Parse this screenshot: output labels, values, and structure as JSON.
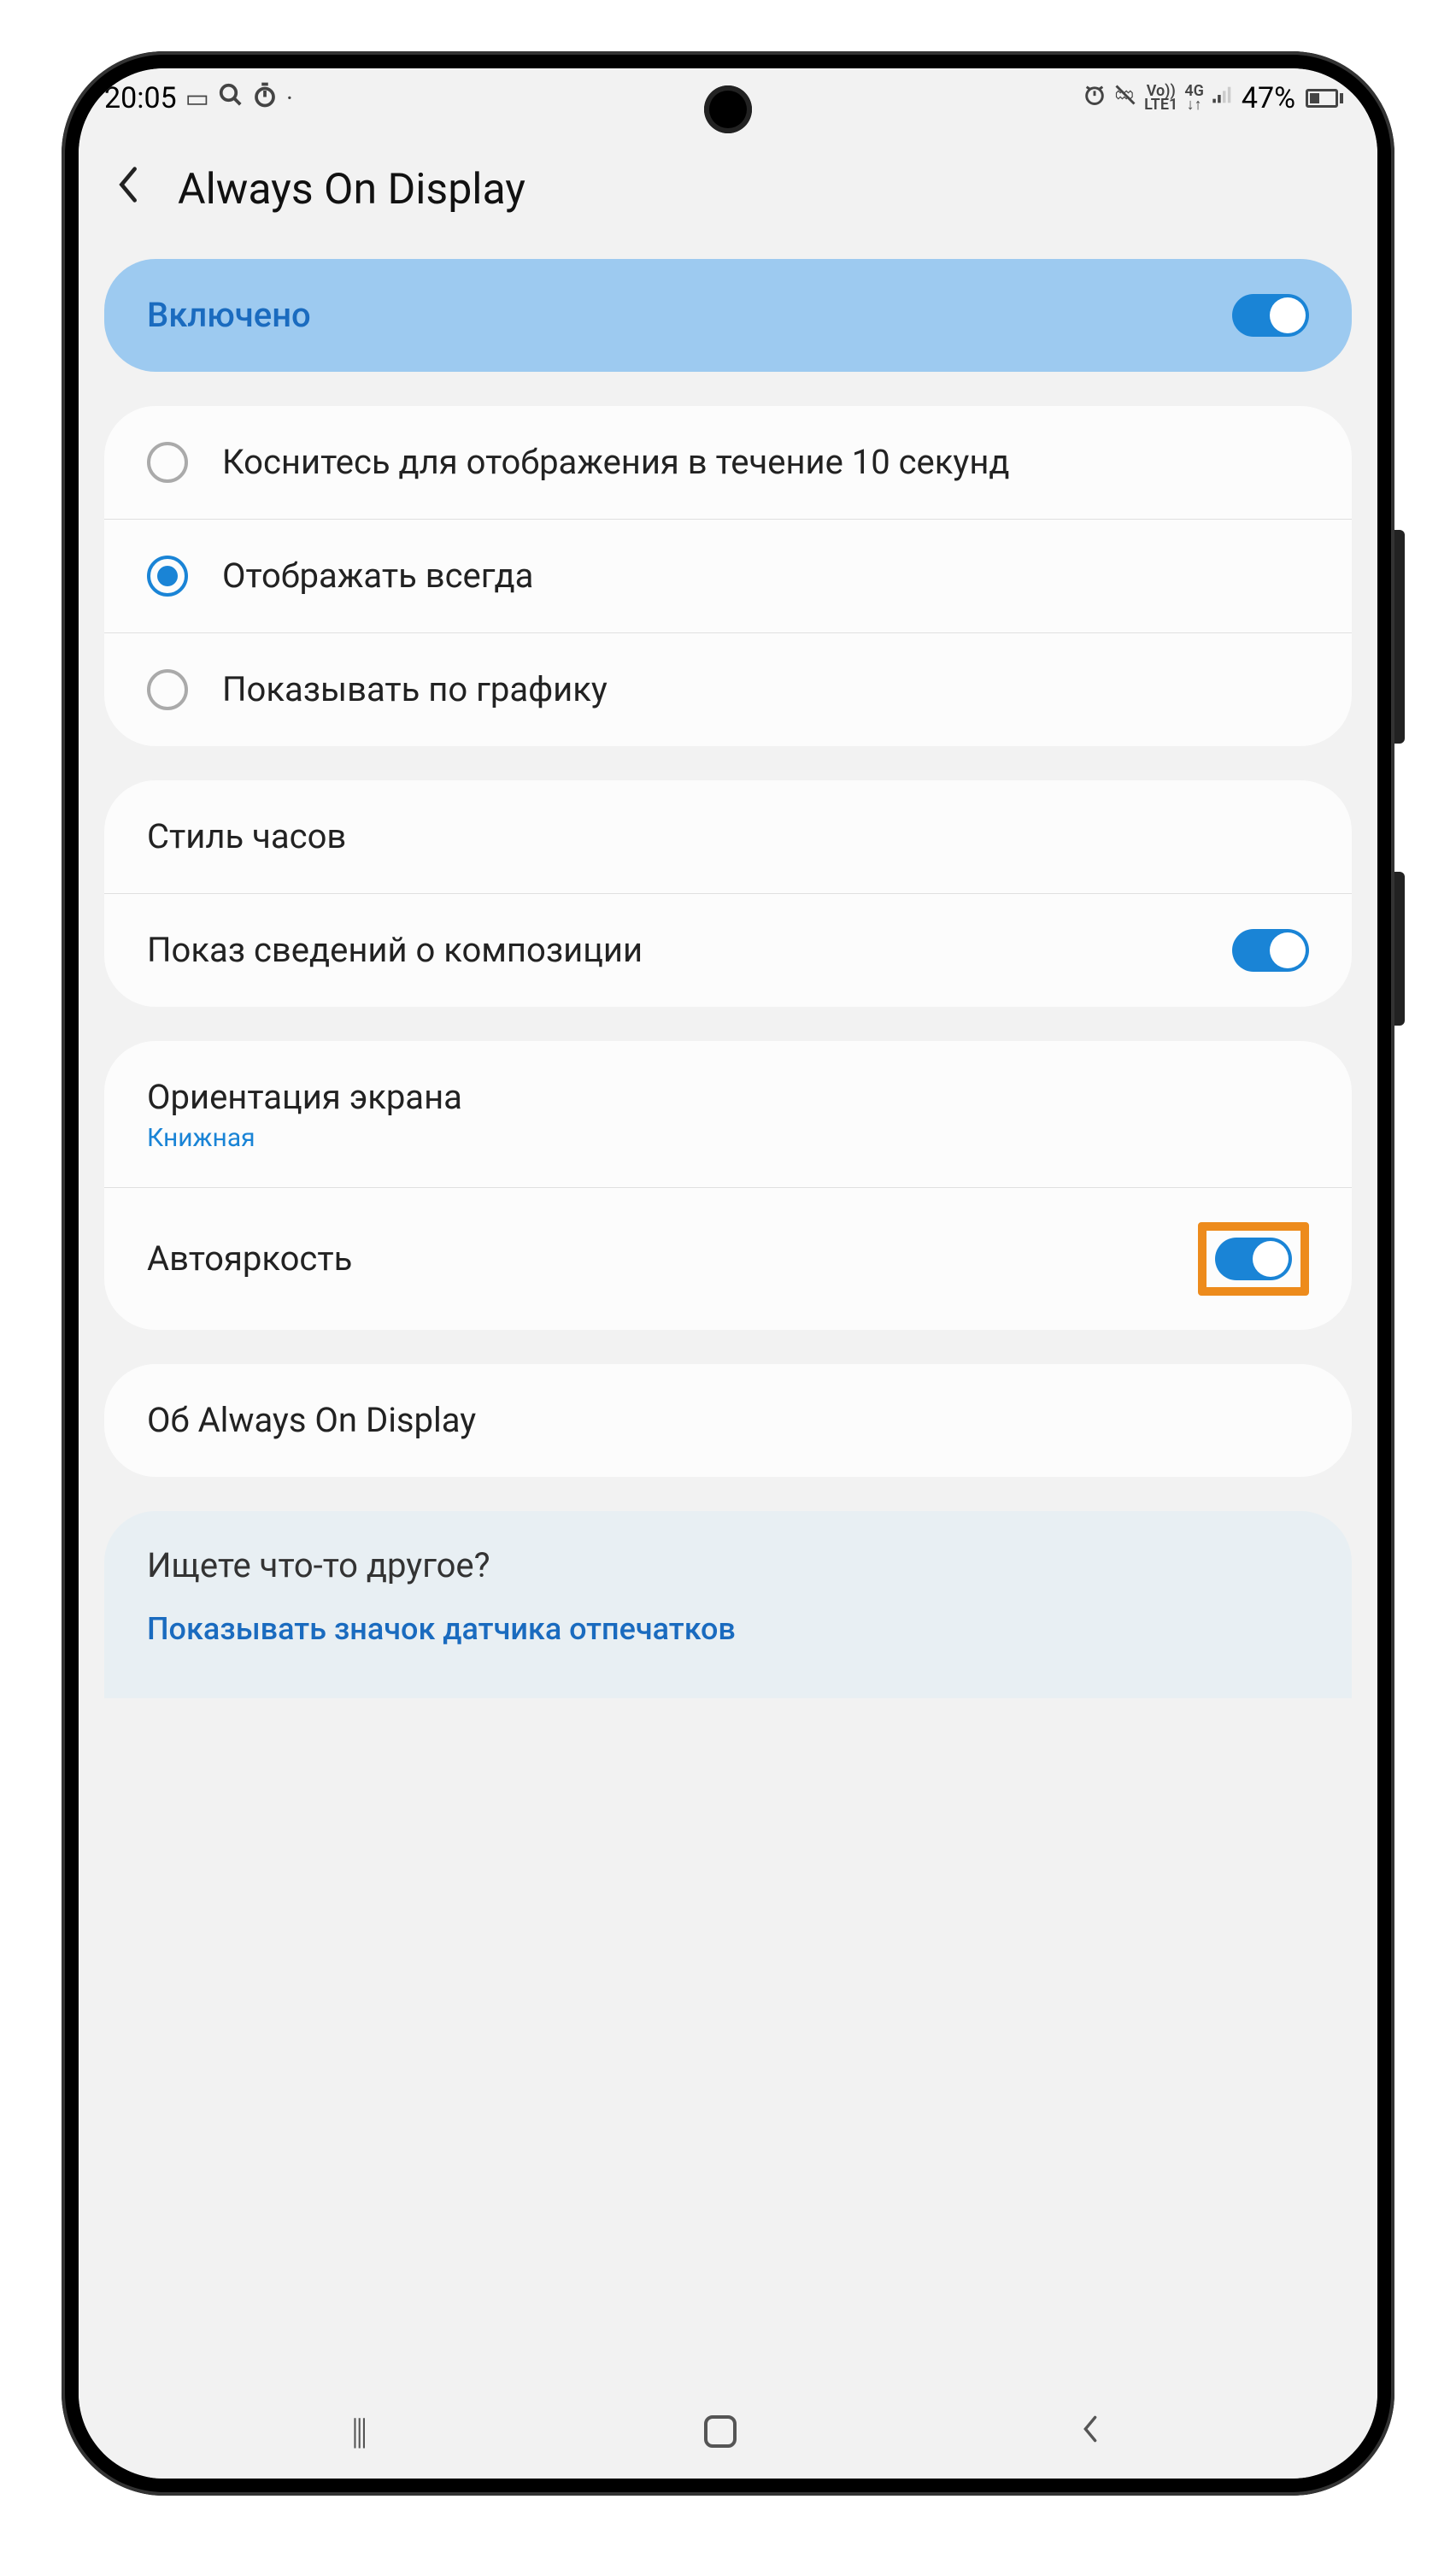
{
  "status": {
    "time": "20:05",
    "battery": "47%"
  },
  "header": {
    "title": "Always On Display"
  },
  "main_toggle": {
    "label": "Включено",
    "on": true
  },
  "display_mode": {
    "options": [
      {
        "label": "Коснитесь для отображения в течение 10 секунд",
        "selected": false
      },
      {
        "label": "Отображать всегда",
        "selected": true
      },
      {
        "label": "Показывать по графику",
        "selected": false
      }
    ]
  },
  "clock_section": {
    "clock_style": "Стиль часов",
    "music_info": {
      "label": "Показ сведений о композиции",
      "on": true
    }
  },
  "screen_section": {
    "orientation": {
      "label": "Ориентация экрана",
      "value": "Книжная"
    },
    "auto_brightness": {
      "label": "Автояркость",
      "on": true
    }
  },
  "about": {
    "label": "Об Always On Display"
  },
  "footer": {
    "title": "Ищете что-то другое?",
    "link": "Показывать значок датчика отпечатков"
  },
  "status_icons": {
    "vo": "Vo))",
    "lte": "LTE1",
    "net": "4G",
    "arrows": "↓↑"
  }
}
